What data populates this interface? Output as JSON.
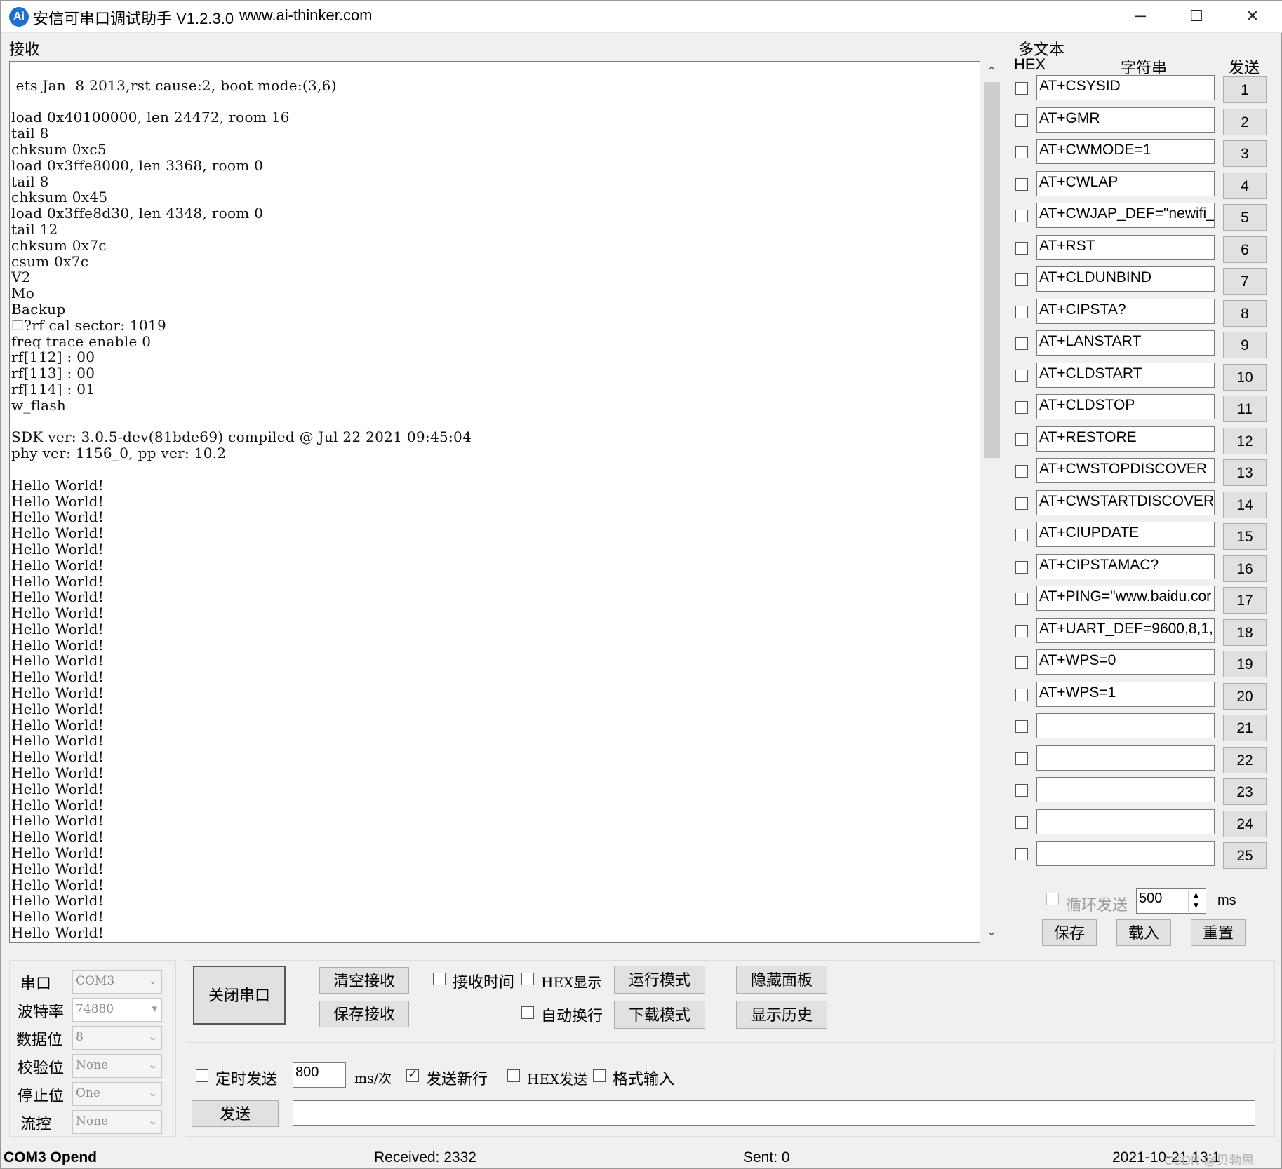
{
  "window": {
    "title": "安信可串口调试助手 V1.2.3.0",
    "url": "www.ai-thinker.com",
    "icon_text": "Ai",
    "controls": [
      "─",
      "☐",
      "✕"
    ]
  },
  "receive": {
    "label": "接收",
    "text": "\n ets Jan  8 2013,rst cause:2, boot mode:(3,6)\n\nload 0x40100000, len 24472, room 16 \ntail 8\nchksum 0xc5\nload 0x3ffe8000, len 3368, room 0 \ntail 8\nchksum 0x45\nload 0x3ffe8d30, len 4348, room 0 \ntail 12\nchksum 0x7c\ncsum 0x7c\nV2\nMo\nBackup\n☐?rf cal sector: 1019\nfreq trace enable 0\nrf[112] : 00\nrf[113] : 00\nrf[114] : 01\nw_flash\n\nSDK ver: 3.0.5-dev(81bde69) compiled @ Jul 22 2021 09:45:04\nphy ver: 1156_0, pp ver: 10.2\n\nHello World!\nHello World!\nHello World!\nHello World!\nHello World!\nHello World!\nHello World!\nHello World!\nHello World!\nHello World!\nHello World!\nHello World!\nHello World!\nHello World!\nHello World!\nHello World!\nHello World!\nHello World!\nHello World!\nHello World!\nHello World!\nHello World!\nHello World!\nHello World!\nHello World!\nHello World!\nHello World!\nHello World!\nHello World!",
    "scroll_up": "⌃",
    "scroll_down": "⌄"
  },
  "multi": {
    "group_label": "多文本",
    "col_hex": "HEX",
    "col_string": "字符串",
    "col_send": "发送",
    "rows": [
      {
        "text": "AT+CSYSID",
        "num": "1"
      },
      {
        "text": "AT+GMR",
        "num": "2"
      },
      {
        "text": "AT+CWMODE=1",
        "num": "3"
      },
      {
        "text": "AT+CWLAP",
        "num": "4"
      },
      {
        "text": "AT+CWJAP_DEF=\"newifi_",
        "num": "5"
      },
      {
        "text": "AT+RST",
        "num": "6"
      },
      {
        "text": "AT+CLDUNBIND",
        "num": "7"
      },
      {
        "text": "AT+CIPSTA?",
        "num": "8"
      },
      {
        "text": "AT+LANSTART",
        "num": "9"
      },
      {
        "text": "AT+CLDSTART",
        "num": "10"
      },
      {
        "text": "AT+CLDSTOP",
        "num": "11"
      },
      {
        "text": "AT+RESTORE",
        "num": "12"
      },
      {
        "text": "AT+CWSTOPDISCOVER",
        "num": "13"
      },
      {
        "text": "AT+CWSTARTDISCOVER=",
        "num": "14"
      },
      {
        "text": "AT+CIUPDATE",
        "num": "15"
      },
      {
        "text": "AT+CIPSTAMAC?",
        "num": "16"
      },
      {
        "text": "AT+PING=\"www.baidu.cor",
        "num": "17"
      },
      {
        "text": "AT+UART_DEF=9600,8,1,",
        "num": "18"
      },
      {
        "text": "AT+WPS=0",
        "num": "19"
      },
      {
        "text": "AT+WPS=1",
        "num": "20"
      },
      {
        "text": "",
        "num": "21"
      },
      {
        "text": "",
        "num": "22"
      },
      {
        "text": "",
        "num": "23"
      },
      {
        "text": "",
        "num": "24"
      },
      {
        "text": "",
        "num": "25"
      }
    ],
    "loop_label": "循环发送",
    "loop_value": "500",
    "loop_unit": "ms",
    "save": "保存",
    "load": "载入",
    "reset": "重置"
  },
  "port": {
    "port_label": "串口",
    "port_value": "COM3",
    "baud_label": "波特率",
    "baud_value": "74880",
    "data_label": "数据位",
    "data_value": "8",
    "parity_label": "校验位",
    "parity_value": "None",
    "stop_label": "停止位",
    "stop_value": "One",
    "flow_label": "流控",
    "flow_value": "None"
  },
  "controls": {
    "close_port": "关闭串口",
    "clear_recv": "清空接收",
    "save_recv": "保存接收",
    "recv_time": "接收时间",
    "hex_display": "HEX显示",
    "auto_wrap": "自动换行",
    "run_mode": "运行模式",
    "download_mode": "下载模式",
    "hide_panel": "隐藏面板",
    "show_history": "显示历史"
  },
  "send": {
    "timed_send": "定时发送",
    "interval": "800",
    "interval_unit": "ms/次",
    "send_newline": "发送新行",
    "hex_send": "HEX发送",
    "format_input": "格式输入",
    "send_button": "发送",
    "send_text": ""
  },
  "statusbar": {
    "port_status": "COM3 Opend",
    "received": "Received: 2332",
    "sent": "Sent: 0",
    "time": "2021-10-21 13:1",
    "watermark": "CSDN @贝勃思"
  }
}
